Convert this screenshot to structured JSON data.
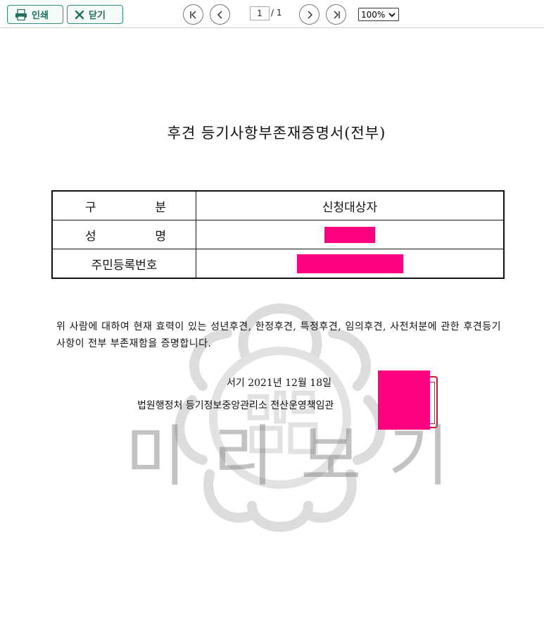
{
  "toolbar": {
    "print_label": "인쇄",
    "close_label": "닫기",
    "page_current": "1",
    "page_sep": "/ 1",
    "zoom": "100%"
  },
  "document": {
    "title": "후견 등기사항부존재증명서(전부)",
    "table": {
      "header_label_chars": [
        "구",
        "분"
      ],
      "header_value": "신청대상자",
      "name_label_chars": [
        "성",
        "명"
      ],
      "id_label": "주민등록번호"
    },
    "statement": "위 사람에 대하여 현재 효력이 있는 성년후견, 한정후견, 특정후견, 임의후견, 사전처분에 관한 후견등기사항이 전부 부존재함을 증명합니다.",
    "date": "서기 2021년 12월 18일",
    "issuer": "법원행정처 등기정보중앙관리소 전산운영책임관",
    "redaction_color": "#ff0080",
    "seal_color": "#d4142a"
  },
  "watermark": {
    "chars": [
      "미",
      "리",
      "보",
      "기"
    ]
  }
}
